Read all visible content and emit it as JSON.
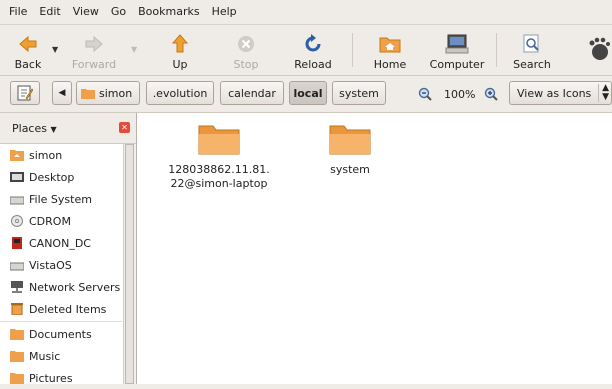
{
  "menubar": {
    "items": [
      "File",
      "Edit",
      "View",
      "Go",
      "Bookmarks",
      "Help"
    ]
  },
  "toolbar": {
    "back": "Back",
    "forward": "Forward",
    "up": "Up",
    "stop": "Stop",
    "reload": "Reload",
    "home": "Home",
    "computer": "Computer",
    "search": "Search"
  },
  "location": {
    "crumbs": [
      "simon",
      ".evolution",
      "calendar",
      "local",
      "system"
    ],
    "zoom": "100%",
    "view": "View as Icons"
  },
  "sidebar": {
    "title": "Places",
    "items": [
      "simon",
      "Desktop",
      "File System",
      "CDROM",
      "CANON_DC",
      "VistaOS",
      "Network Servers",
      "Deleted Items",
      "Documents",
      "Music",
      "Pictures"
    ]
  },
  "files": [
    {
      "name": "128038862.11.81.\n22@simon-laptop"
    },
    {
      "name": "system"
    }
  ],
  "colors": {
    "folder": "#f0a04b",
    "accent": "#e34b3c"
  }
}
